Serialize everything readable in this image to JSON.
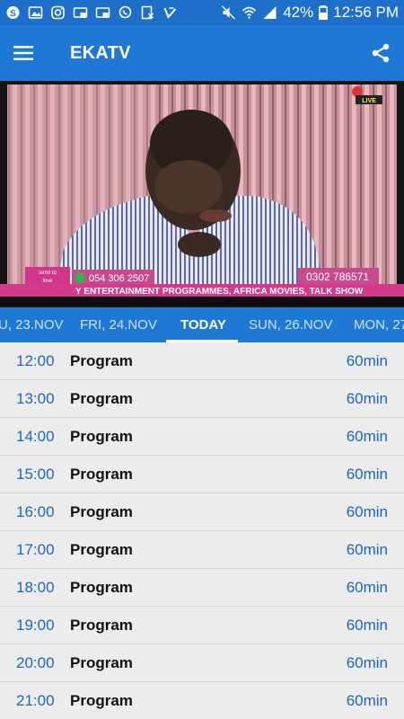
{
  "status_bar": {
    "battery": "42%",
    "time": "12:56 PM",
    "icons": [
      "skype-icon",
      "image-icon",
      "instagram-icon",
      "cast-icon",
      "cast-icon",
      "whatsapp-icon",
      "app-icon",
      "check-icon"
    ]
  },
  "app_bar": {
    "title": "EKATV"
  },
  "video": {
    "ticker": "Y ENTERTAINMENT PROGRAMMES, AFRICA MOVIES, TALK SHOW",
    "phone_left": "054 306 2507",
    "phone_right": "0302 786571",
    "live_badge": "LIVE",
    "send_label": "send to",
    "send_sub": "love"
  },
  "tabs": [
    {
      "label": "U, 23.NOV"
    },
    {
      "label": "FRI, 24.NOV"
    },
    {
      "label": "TODAY"
    },
    {
      "label": "SUN, 26.NOV"
    },
    {
      "label": "MON, 27"
    }
  ],
  "schedule": [
    {
      "time": "12:00",
      "title": "Program",
      "duration": "60min"
    },
    {
      "time": "13:00",
      "title": "Program",
      "duration": "60min"
    },
    {
      "time": "14:00",
      "title": "Program",
      "duration": "60min"
    },
    {
      "time": "15:00",
      "title": "Program",
      "duration": "60min"
    },
    {
      "time": "16:00",
      "title": "Program",
      "duration": "60min"
    },
    {
      "time": "17:00",
      "title": "Program",
      "duration": "60min"
    },
    {
      "time": "18:00",
      "title": "Program",
      "duration": "60min"
    },
    {
      "time": "19:00",
      "title": "Program",
      "duration": "60min"
    },
    {
      "time": "20:00",
      "title": "Program",
      "duration": "60min"
    },
    {
      "time": "21:00",
      "title": "Program",
      "duration": "60min"
    }
  ],
  "colors": {
    "primary": "#1f78d6",
    "accent_text": "#1b66c0",
    "list_bg": "#ececec"
  }
}
